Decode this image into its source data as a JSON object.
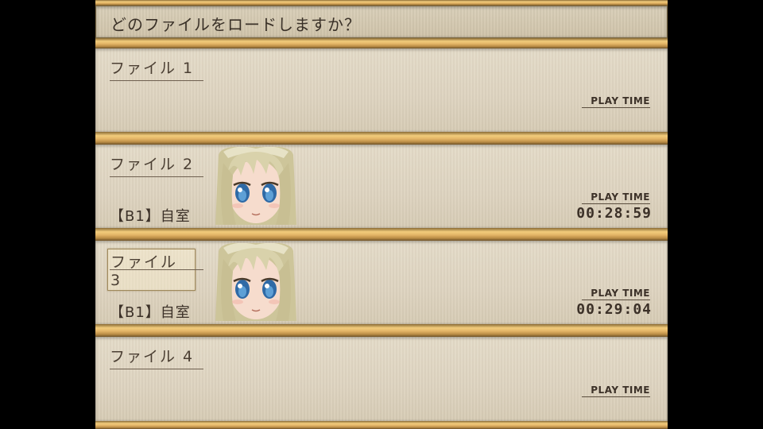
{
  "header": {
    "prompt": "どのファイルをロードしますか？"
  },
  "save_slots": [
    {
      "label": "ファイル 1",
      "has_data": false,
      "location": "",
      "playtime_label": "PLAY TIME",
      "playtime": ""
    },
    {
      "label": "ファイル 2",
      "has_data": true,
      "location": "【B1】自室",
      "playtime_label": "PLAY TIME",
      "playtime": "00:28:59"
    },
    {
      "label": "ファイル 3",
      "has_data": true,
      "selected": true,
      "location": "【B1】自室",
      "playtime_label": "PLAY TIME",
      "playtime": "00:29:04"
    },
    {
      "label": "ファイル 4",
      "has_data": false,
      "location": "",
      "playtime_label": "PLAY TIME",
      "playtime": ""
    }
  ],
  "colors": {
    "panel_bg": "#ddd3bf",
    "bar_gold": "#e3b466",
    "text_dark": "#3c3128"
  },
  "icons": {
    "portrait": "character-portrait-icon"
  }
}
